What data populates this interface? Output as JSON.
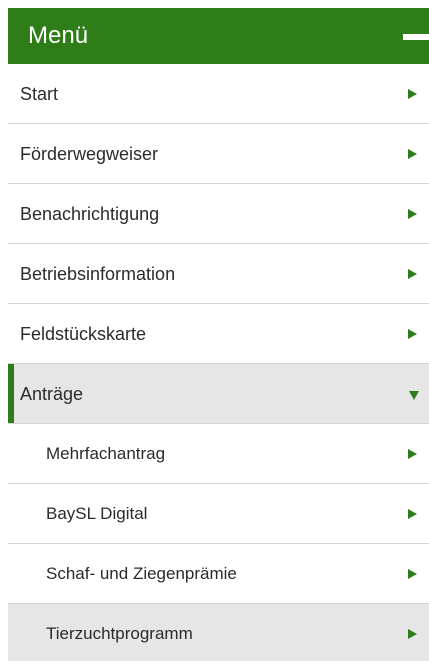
{
  "menu": {
    "title": "Menü",
    "collapse_icon": "minus-icon",
    "accent_color": "#2f7d19",
    "items": [
      {
        "label": "Start",
        "icon": "triangle-right-icon"
      },
      {
        "label": "Förderwegweiser",
        "icon": "triangle-right-icon"
      },
      {
        "label": "Benachrichtigung",
        "icon": "triangle-right-icon"
      },
      {
        "label": "Betriebsinformation",
        "icon": "triangle-right-icon"
      },
      {
        "label": "Feldstückskarte",
        "icon": "triangle-right-icon"
      },
      {
        "label": "Anträge",
        "icon": "triangle-down-icon",
        "expanded": true
      }
    ],
    "subitems": [
      {
        "label": "Mehrfachantrag",
        "icon": "triangle-right-icon"
      },
      {
        "label": "BaySL Digital",
        "icon": "triangle-right-icon"
      },
      {
        "label": "Schaf- und Ziegenprämie",
        "icon": "triangle-right-icon"
      },
      {
        "label": "Tierzuchtprogramm",
        "icon": "triangle-right-icon",
        "highlighted": true
      }
    ]
  }
}
